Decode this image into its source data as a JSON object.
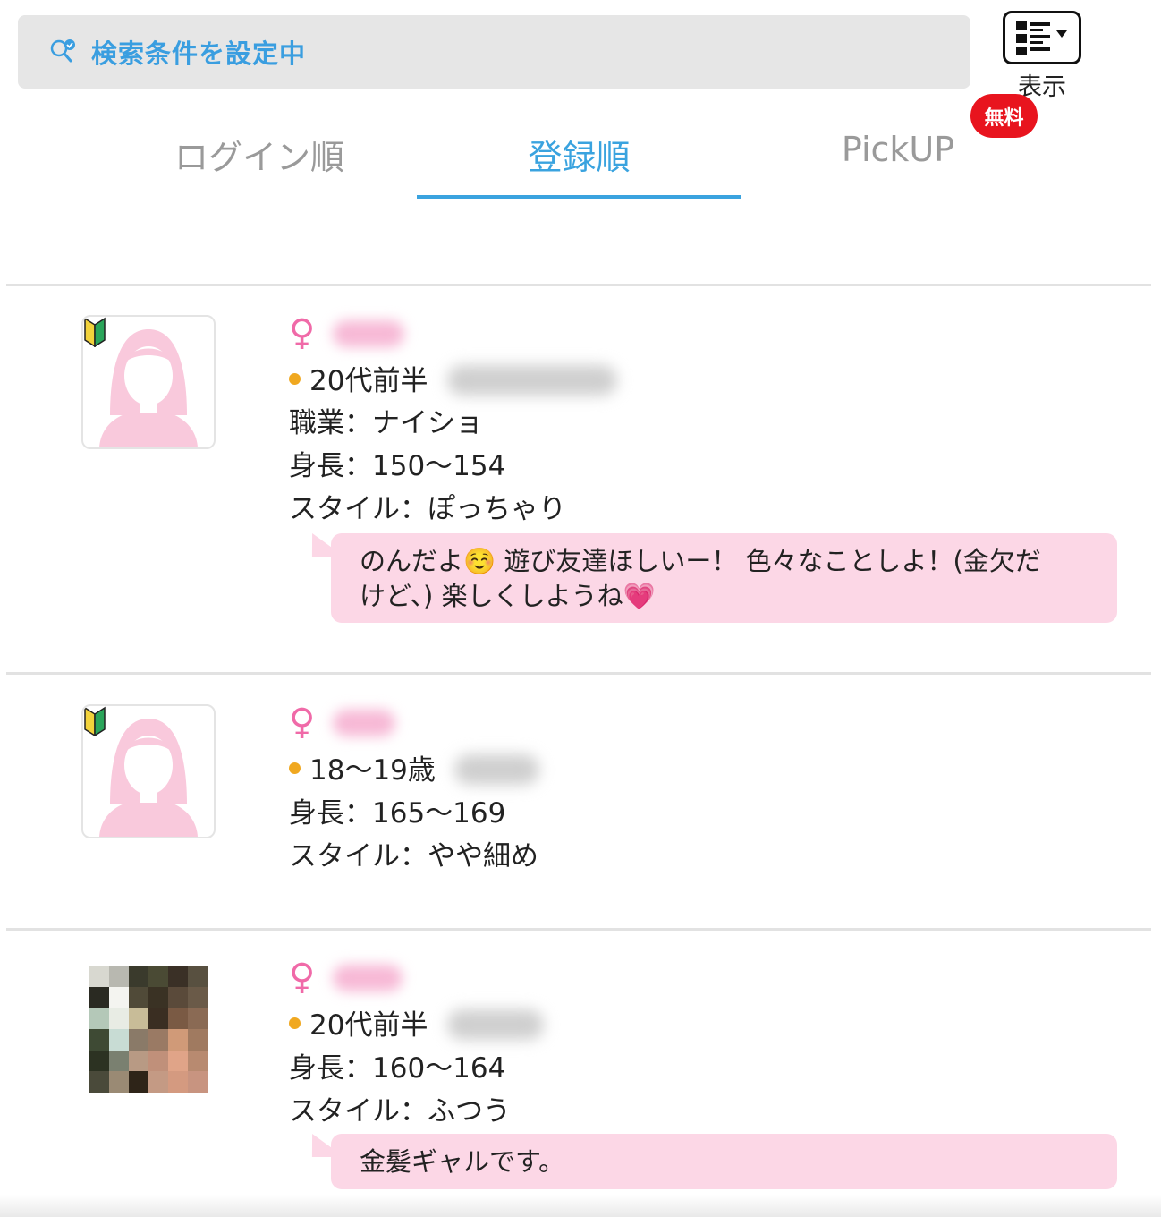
{
  "search": {
    "label": "検索条件を設定中"
  },
  "display": {
    "label": "表示"
  },
  "tabs": [
    {
      "label": "ログイン順",
      "active": false
    },
    {
      "label": "登録順",
      "active": true
    },
    {
      "label": "PickUP",
      "active": false,
      "badge": "無料"
    }
  ],
  "profiles": [
    {
      "gender": "♀",
      "age": "20代前半",
      "lines": [
        "職業：ナイショ",
        "身長：150〜154",
        "スタイル：ぽっちゃり"
      ],
      "message_line1": "のんだよ☺️ 遊び友達ほしいー！ 色々なことしよ！(金欠だ",
      "message_line2": "けど、) 楽しくしようね💗",
      "beginner": true
    },
    {
      "gender": "♀",
      "age": "18〜19歳",
      "lines": [
        "身長：165〜169",
        "スタイル：やや細め"
      ],
      "beginner": true
    },
    {
      "gender": "♀",
      "age": "20代前半",
      "lines": [
        "身長：160〜164",
        "スタイル：ふつう"
      ],
      "message_line1": "金髪ギャルです。",
      "beginner": false
    }
  ],
  "colors": {
    "accent": "#3aa3df",
    "badge": "#e8141e",
    "gender": "#f06aa8",
    "bubble": "#fcd7e6",
    "status_dot": "#f0a820"
  }
}
